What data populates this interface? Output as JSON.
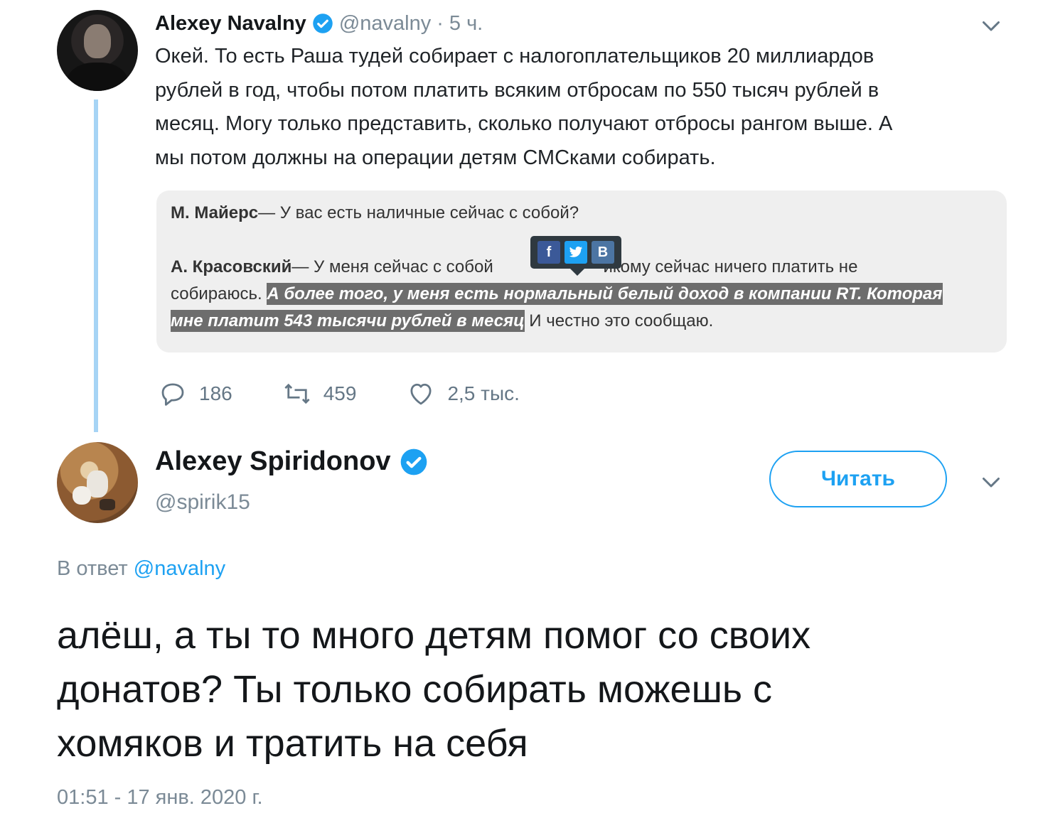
{
  "tweet1": {
    "author_name": "Alexey Navalny",
    "handle": "@navalny",
    "separator": "·",
    "time": "5 ч.",
    "text_lines": [
      "Окей. То есть Раша тудей собирает с налогоплательщиков 20 миллиардов",
      "рублей в год, чтобы потом платить всяким отбросам по 550 тысяч рублей в",
      "месяц. Могу только представить, сколько получают отбросы рангом выше. А",
      "мы потом должны на операции детям СМСками собирать."
    ],
    "quote": {
      "line1_speaker": "М. Майерс",
      "line1_text": "— У вас есть наличные сейчас с собой?",
      "line2_speaker": "А. Красовский",
      "line2_text_a": "— У меня сейчас с собой ",
      "line2_text_b": "икому сейчас ничего платить не",
      "line3_plain": "собираюсь. ",
      "line3_highlight": "А более того, у меня есть нормальный белый доход в компании RT. Которая",
      "line4_highlight": "мне платит 543 тысячи рублей в месяц",
      "line4_plain": " И честно это сообщаю.",
      "share_buttons": [
        "f",
        "t",
        "В"
      ]
    },
    "replies_count": "186",
    "retweets_count": "459",
    "likes_count": "2,5 тыс."
  },
  "tweet2": {
    "author_name": "Alexey Spiridonov",
    "handle": "@spirik15",
    "follow_label": "Читать",
    "reply_prefix": "В ответ ",
    "reply_mention": "@navalny",
    "text_lines": [
      "алёш, а ты то много детям помог со своих",
      "донатов? Ты только собирать можешь с",
      "хомяков и тратить на себя"
    ],
    "timestamp": "01:51 - 17 янв. 2020 г."
  },
  "colors": {
    "accent": "#1da1f2",
    "thread_line": "#a6d4f5",
    "muted": "#7b8a96"
  },
  "icons": [
    "verified-badge-icon",
    "chevron-down-icon",
    "reply-icon",
    "retweet-icon",
    "like-icon"
  ]
}
